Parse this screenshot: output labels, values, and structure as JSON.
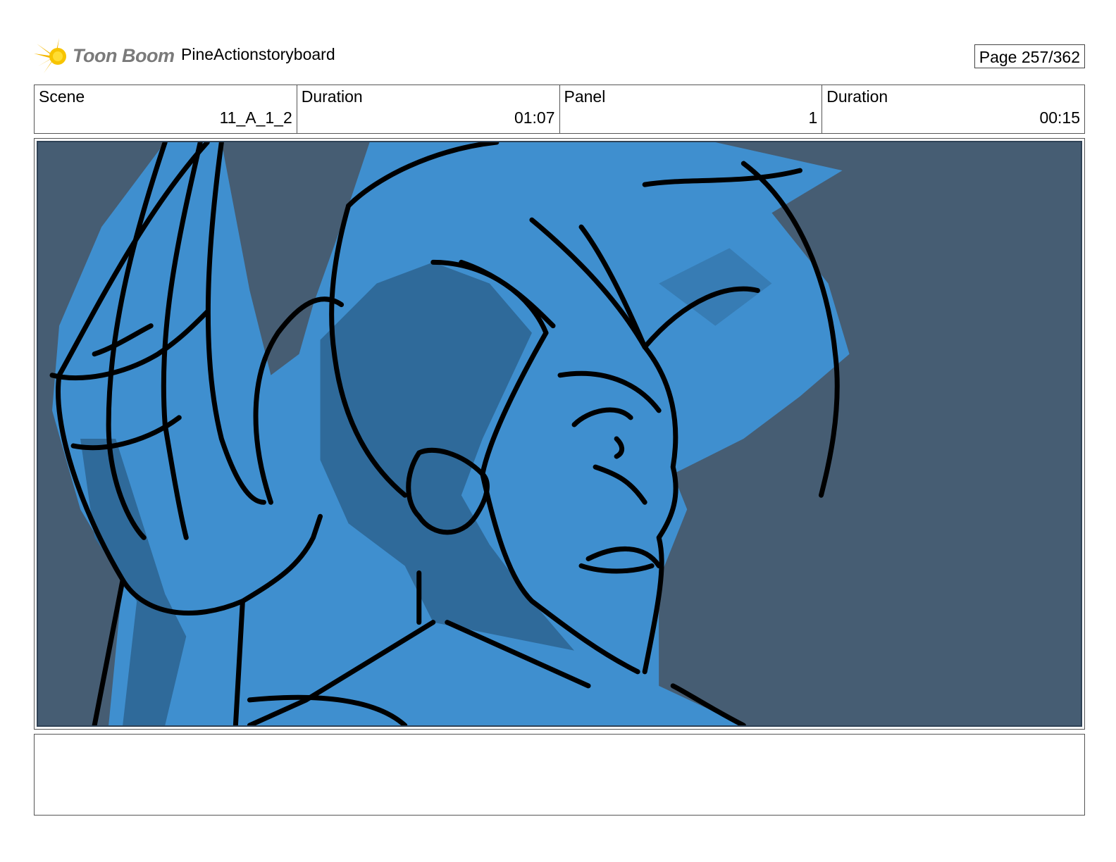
{
  "header": {
    "logo_text": "Toon Boom",
    "project_title": "PineActionstoryboard",
    "page_label": "Page 257/362"
  },
  "info": {
    "scene_label": "Scene",
    "scene_value": "11_A_1_2",
    "scene_duration_label": "Duration",
    "scene_duration_value": "01:07",
    "panel_label": "Panel",
    "panel_value": "1",
    "panel_duration_label": "Duration",
    "panel_duration_value": "00:15"
  },
  "panel": {
    "background_color": "#465d73",
    "character_fill": "#3f8fcf",
    "character_shadow": "#2f6a9a",
    "line_color": "#000000"
  },
  "notes": {
    "text": ""
  }
}
